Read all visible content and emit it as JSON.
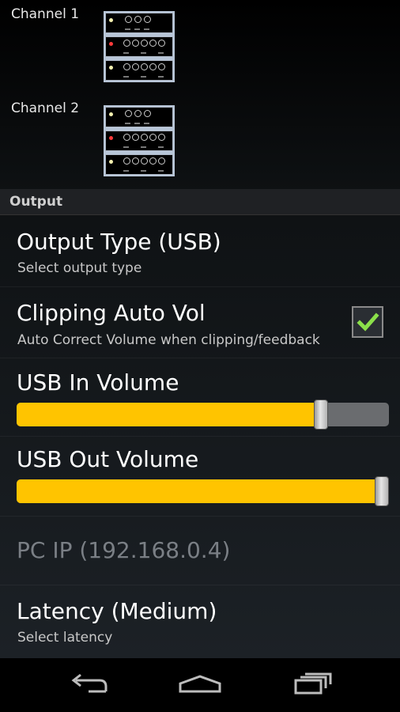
{
  "channels": [
    {
      "label": "Channel 1",
      "led_colors": [
        "#f4f0b0",
        "#ff3b3b",
        "#f4f0b0"
      ]
    },
    {
      "label": "Channel 2",
      "led_colors": [
        "#f4f0b0",
        "#ff3b3b",
        "#f4f0b0"
      ]
    }
  ],
  "section": {
    "title": "Output"
  },
  "prefs": {
    "output_type": {
      "title": "Output Type (USB)",
      "summary": "Select output type"
    },
    "clipping": {
      "title": "Clipping Auto Vol",
      "summary": "Auto Correct Volume when clipping/feedback",
      "checked": true
    },
    "usb_in": {
      "title": "USB In Volume",
      "value_fraction": 0.83
    },
    "usb_out": {
      "title": "USB Out Volume",
      "value_fraction": 1.0
    },
    "pc_ip": {
      "title": "PC IP (192.168.0.4)",
      "disabled": true
    },
    "latency": {
      "title": "Latency (Medium)",
      "summary": "Select latency"
    }
  },
  "colors": {
    "accent": "#ffc400",
    "check": "#8be04a"
  },
  "navbar": {
    "icons": [
      "back-icon",
      "home-icon",
      "recent-apps-icon"
    ]
  }
}
